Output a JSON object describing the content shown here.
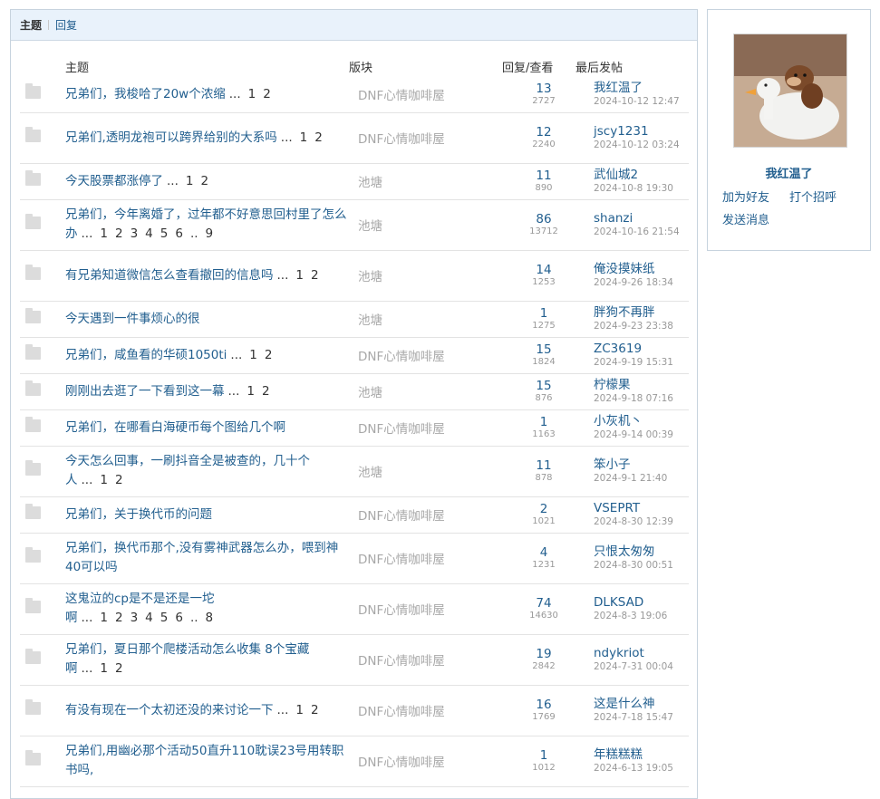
{
  "tabs": {
    "active": "主题",
    "link": "回复"
  },
  "columns": {
    "title": "主题",
    "forum": "版块",
    "replies": "回复/查看",
    "last": "最后发帖"
  },
  "topics": [
    {
      "title": "兄弟们，我梭哈了20w个浓缩",
      "pages": [
        "...",
        "1",
        "2"
      ],
      "forum": "DNF心情咖啡屋",
      "replies": "13",
      "views": "2727",
      "last_user": "我红温了",
      "last_date": "2024-10-12 12:47"
    },
    {
      "title": "兄弟们,透明龙袍可以跨界给别的大系吗",
      "pages": [
        "...",
        "1",
        "2"
      ],
      "forum": "DNF心情咖啡屋",
      "replies": "12",
      "views": "2240",
      "last_user": "jscy1231",
      "last_date": "2024-10-12 03:24"
    },
    {
      "title": "今天股票都涨停了",
      "pages": [
        "...",
        "1",
        "2"
      ],
      "forum": "池塘",
      "replies": "11",
      "views": "890",
      "last_user": "武仙城2",
      "last_date": "2024-10-8 19:30"
    },
    {
      "title": "兄弟们，今年离婚了，过年都不好意思回村里了怎么办",
      "pages": [
        "...",
        "1",
        "2",
        "3",
        "4",
        "5",
        "6",
        "..",
        "9"
      ],
      "forum": "池塘",
      "replies": "86",
      "views": "13712",
      "last_user": "shanzi",
      "last_date": "2024-10-16 21:54"
    },
    {
      "title": "有兄弟知道微信怎么查看撤回的信息吗",
      "pages": [
        "...",
        "1",
        "2"
      ],
      "forum": "池塘",
      "replies": "14",
      "views": "1253",
      "last_user": "俺没摸妹纸",
      "last_date": "2024-9-26 18:34"
    },
    {
      "title": "今天遇到一件事烦心的很",
      "pages": [],
      "forum": "池塘",
      "replies": "1",
      "views": "1275",
      "last_user": "胖狗不再胖",
      "last_date": "2024-9-23 23:38"
    },
    {
      "title": "兄弟们，咸鱼看的华硕1050ti",
      "pages": [
        "...",
        "1",
        "2"
      ],
      "forum": "DNF心情咖啡屋",
      "replies": "15",
      "views": "1824",
      "last_user": "ZC3619",
      "last_date": "2024-9-19 15:31"
    },
    {
      "title": "刚刚出去逛了一下看到这一幕",
      "pages": [
        "...",
        "1",
        "2"
      ],
      "forum": "池塘",
      "replies": "15",
      "views": "876",
      "last_user": "柠檬果",
      "last_date": "2024-9-18 07:16"
    },
    {
      "title": "兄弟们，在哪看白海硬币每个图给几个啊",
      "pages": [],
      "forum": "DNF心情咖啡屋",
      "replies": "1",
      "views": "1163",
      "last_user": "小灰机丶",
      "last_date": "2024-9-14 00:39"
    },
    {
      "title": "今天怎么回事，一刷抖音全是被查的，几十个人",
      "pages": [
        "...",
        "1",
        "2"
      ],
      "forum": "池塘",
      "replies": "11",
      "views": "878",
      "last_user": "笨小子",
      "last_date": "2024-9-1 21:40"
    },
    {
      "title": "兄弟们，关于换代币的问题",
      "pages": [],
      "forum": "DNF心情咖啡屋",
      "replies": "2",
      "views": "1021",
      "last_user": "VSEPRT",
      "last_date": "2024-8-30 12:39"
    },
    {
      "title": "兄弟们，换代币那个,没有雾神武器怎么办，喂到神40可以吗",
      "pages": [],
      "forum": "DNF心情咖啡屋",
      "replies": "4",
      "views": "1231",
      "last_user": "只恨太匆匆",
      "last_date": "2024-8-30 00:51"
    },
    {
      "title": "这鬼泣的cp是不是还是一坨啊",
      "pages": [
        "...",
        "1",
        "2",
        "3",
        "4",
        "5",
        "6",
        "..",
        "8"
      ],
      "forum": "DNF心情咖啡屋",
      "replies": "74",
      "views": "14630",
      "last_user": "DLKSAD",
      "last_date": "2024-8-3 19:06"
    },
    {
      "title": "兄弟们，夏日那个爬楼活动怎么收集 8个宝藏啊",
      "pages": [
        "...",
        "1",
        "2"
      ],
      "forum": "DNF心情咖啡屋",
      "replies": "19",
      "views": "2842",
      "last_user": "ndykriot",
      "last_date": "2024-7-31 00:04"
    },
    {
      "title": "有没有现在一个太初还没的来讨论一下",
      "pages": [
        "...",
        "1",
        "2"
      ],
      "forum": "DNF心情咖啡屋",
      "replies": "16",
      "views": "1769",
      "last_user": "这是什么神",
      "last_date": "2024-7-18 15:47"
    },
    {
      "title": "兄弟们,用幽必那个活动50直升110耽误23号用转职书吗,",
      "pages": [],
      "forum": "DNF心情咖啡屋",
      "replies": "1",
      "views": "1012",
      "last_user": "年糕糕糕",
      "last_date": "2024-6-13 19:05"
    }
  ],
  "profile": {
    "username": "我红温了",
    "add_friend": "加为好友",
    "greet": "打个招呼",
    "message": "发送消息"
  },
  "colors": {
    "link": "#225f8f",
    "muted": "#a8a8a8",
    "tab_bg": "#e9f2fb",
    "border": "#c7d3de"
  },
  "icons": {
    "topic": "folder-icon"
  }
}
